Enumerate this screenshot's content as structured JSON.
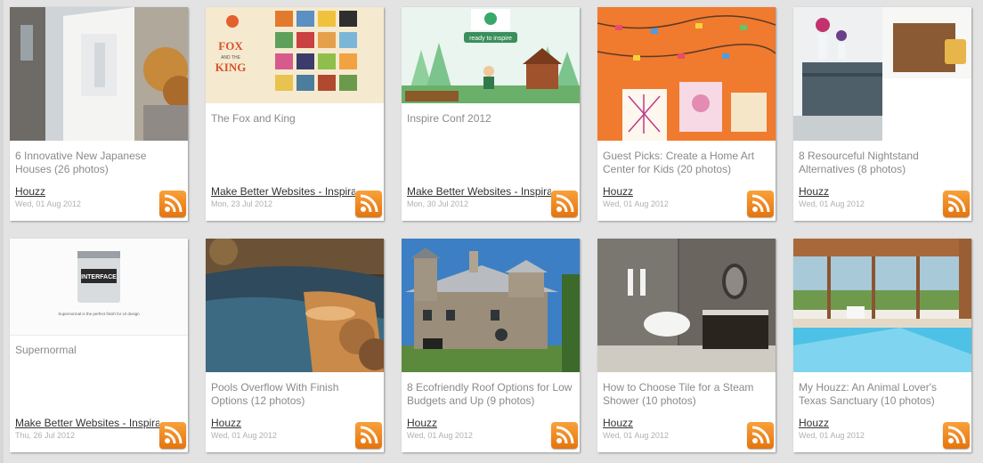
{
  "feed": {
    "cards": [
      {
        "title": "6 Innovative New Japanese Houses (26 photos)",
        "source": "Houzz",
        "date": "Wed, 01 Aug 2012"
      },
      {
        "title": "The Fox and King",
        "source": "Make Better Websites - Inspiration",
        "date": "Mon, 23 Jul 2012",
        "thumb_text": {
          "line1": "FOX",
          "line2": "AND THE",
          "line3": "KING"
        }
      },
      {
        "title": "Inspire Conf 2012",
        "source": "Make Better Websites - Inspiration",
        "date": "Mon, 30 Jul 2012",
        "thumb_text": {
          "banner": "ready to inspire"
        }
      },
      {
        "title": "Guest Picks: Create a Home Art Center for Kids (20 photos)",
        "source": "Houzz",
        "date": "Wed, 01 Aug 2012"
      },
      {
        "title": "8 Resourceful Nightstand Alternatives (8 photos)",
        "source": "Houzz",
        "date": "Wed, 01 Aug 2012"
      },
      {
        "title": "Supernormal",
        "source": "Make Better Websites - Inspiration",
        "date": "Thu, 26 Jul 2012",
        "thumb_text": {
          "label": "INTERFACE",
          "caption": "Supernormal is the perfect finish for UI design"
        }
      },
      {
        "title": "Pools Overflow With Finish Options (12 photos)",
        "source": "Houzz",
        "date": "Wed, 01 Aug 2012"
      },
      {
        "title": "8 Ecofriendly Roof Options for Low Budgets and Up (9 photos)",
        "source": "Houzz",
        "date": "Wed, 01 Aug 2012"
      },
      {
        "title": "How to Choose Tile for a Steam Shower (10 photos)",
        "source": "Houzz",
        "date": "Wed, 01 Aug 2012"
      },
      {
        "title": "My Houzz: An Animal Lover's Texas Sanctuary (10 photos)",
        "source": "Houzz",
        "date": "Wed, 01 Aug 2012"
      }
    ],
    "rss_icon": "rss-feed-icon",
    "colors": {
      "accent": "#f28c1c",
      "background": "#e3e3e3",
      "title": "#8a8a8a"
    }
  }
}
